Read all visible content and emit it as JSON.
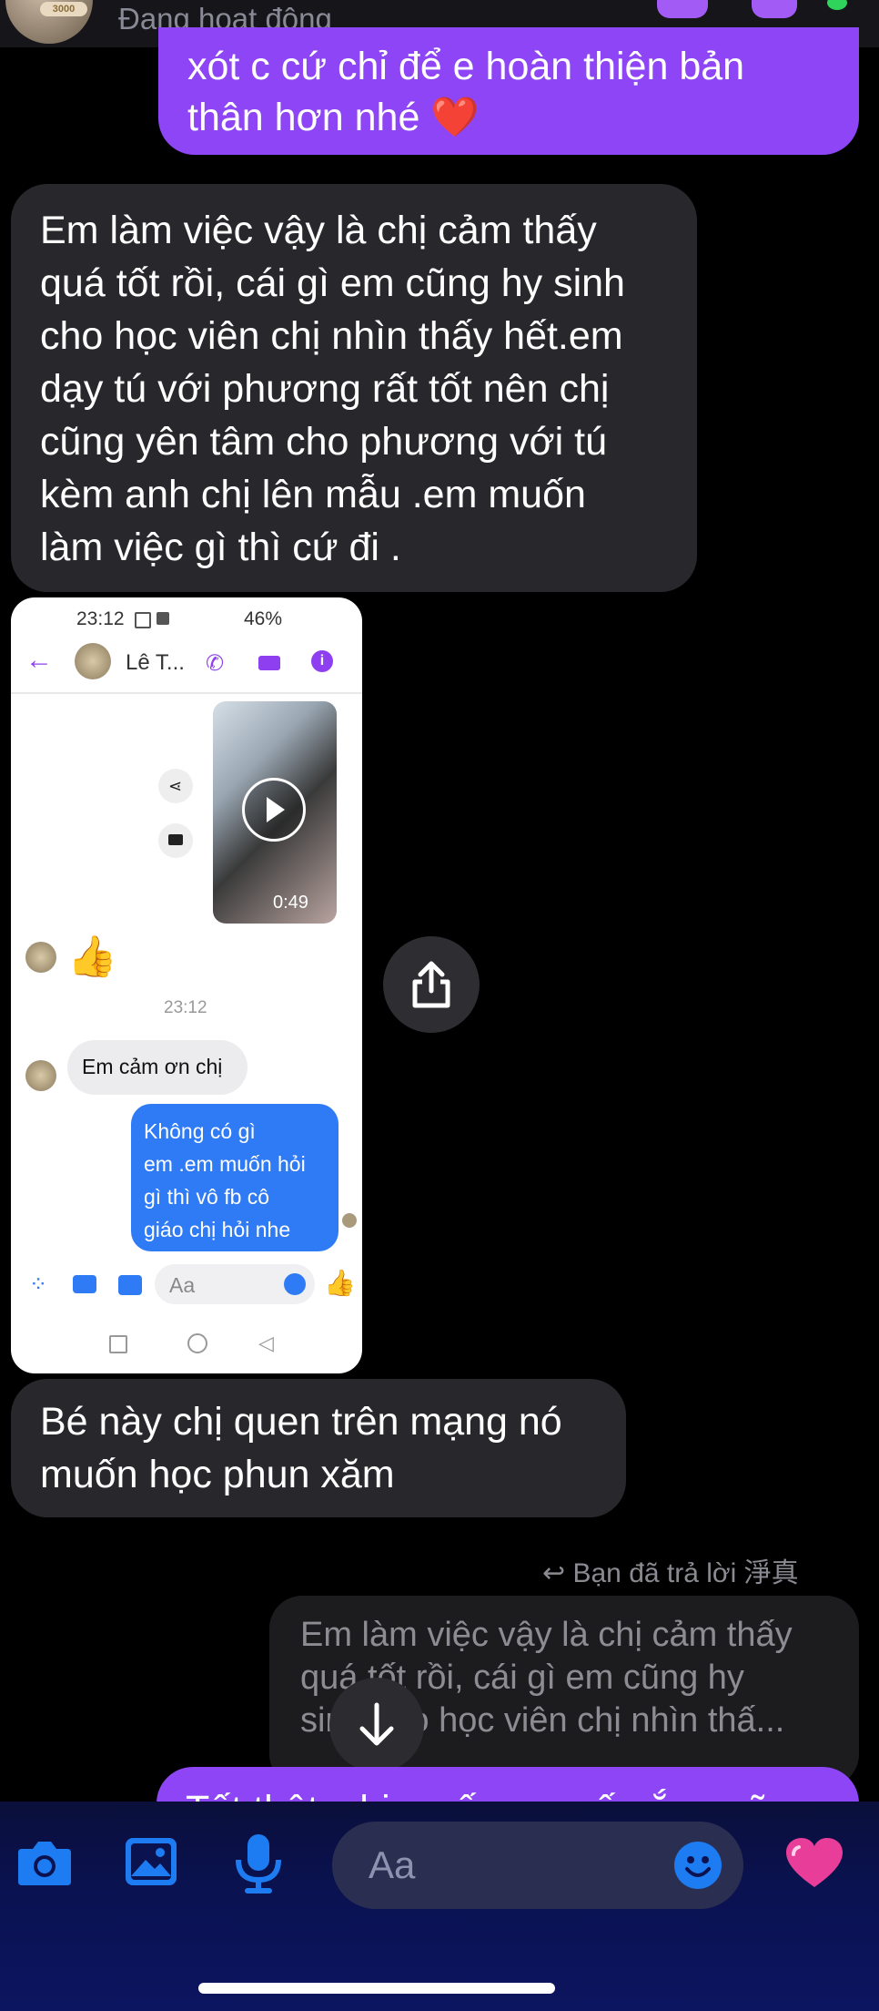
{
  "header": {
    "avatar_badge": "3000",
    "status": "Đang hoạt động"
  },
  "messages": {
    "outgoing_top": {
      "line1": "xót c cứ chỉ để e hoàn thiện bản",
      "line2": "thân hơn nhé",
      "emoji": "❤️"
    },
    "incoming_1": [
      "Em làm việc vậy là chị cảm thấy",
      "quá tốt rồi, cái gì em cũng hy sinh",
      "cho học viên chị nhìn thấy hết.em",
      "dạy tú với phương rất tốt nên chị",
      "cũng yên tâm cho phương với tú",
      "kèm anh chị lên mẫu .em muốn",
      "làm việc gì thì cứ đi ."
    ],
    "incoming_2": [
      "Bé này chị quen trên mạng nó",
      "muốn học phun xăm"
    ],
    "reply_label": "Bạn đã trả lời 淨真",
    "quoted": [
      "Em làm việc vậy là chị cảm thấy",
      "quá tốt rồi, cái gì em cũng hy",
      "sinh cho học viên chị nhìn thấ..."
    ],
    "outgoing_bottom": "Tốt thật, chị muốn em cố gắng nữa..."
  },
  "screenshot": {
    "time": "23:12",
    "battery": "46%",
    "contact": "Lê T...",
    "video_duration": "0:49",
    "timestamp": "23:12",
    "incoming": "Em cảm ơn chị",
    "outgoing": [
      "Không có gì",
      "em .em muốn hỏi",
      "gì thì vô fb cô",
      "giáo chị hỏi nhe"
    ],
    "input_placeholder": "Aa"
  },
  "composer": {
    "placeholder": "Aa"
  },
  "colors": {
    "accent": "#8e45f5",
    "incoming_bubble": "#28282c",
    "composer_bg": "#0a1250"
  }
}
